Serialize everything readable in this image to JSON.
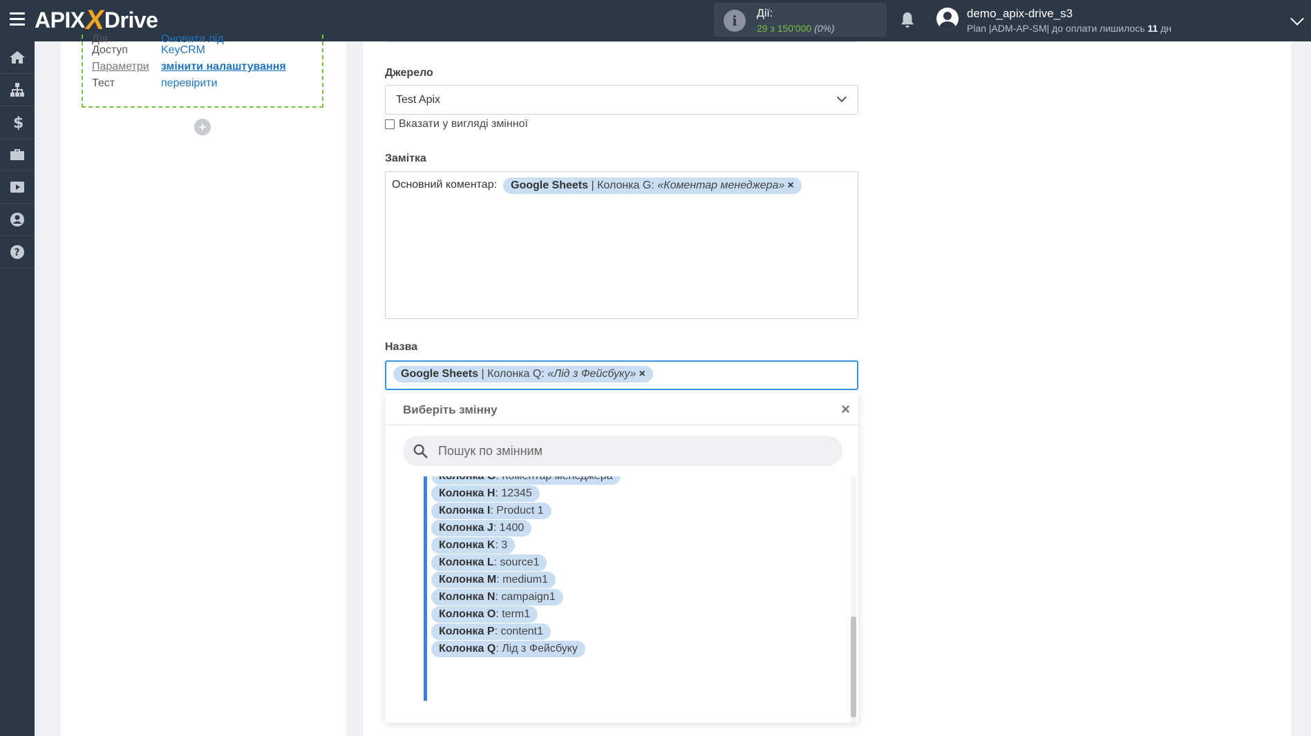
{
  "topbar": {
    "logo_api": "APIX",
    "logo_x": "",
    "logo_drive": "Drive",
    "actions_label": "Дії:",
    "actions_value": "29 з 150'000",
    "actions_percent": "(0%)",
    "username": "demo_apix-drive_s3",
    "plan_text": "Plan |ADM-AP-SM| до оплати лишилось ",
    "plan_days": "11",
    "plan_days_suffix": " дн"
  },
  "sidebar": {
    "items": [
      "home-icon",
      "sitemap-icon",
      "dollar-icon",
      "briefcase-icon",
      "youtube-icon",
      "user-icon",
      "help-icon"
    ]
  },
  "step": {
    "rows": [
      {
        "key": "Дія",
        "value": "Оновити лід"
      },
      {
        "key": "Доступ",
        "value": "KeyCRM"
      },
      {
        "key": "Параметри",
        "value": "змінити налаштування"
      },
      {
        "key": "Тест",
        "value": "перевірити"
      }
    ],
    "add_label": "+"
  },
  "form": {
    "source_label": "Джерело",
    "source_value": "Test Apix",
    "as_variable_label": "Вказати у вигляді змінної",
    "note_label": "Замітка",
    "note_prefix": "Основний коментар:",
    "note_tag_source": "Google Sheets",
    "note_tag_col": " | Колонка G: ",
    "note_tag_value": "«Коментар менеджера»",
    "name_label": "Назва",
    "name_tag_source": "Google Sheets",
    "name_tag_col": " | Колонка Q: ",
    "name_tag_value": "«Лід з Фейсбуку»",
    "tag_remove": "×"
  },
  "dropdown": {
    "title": "Виберіть змінну",
    "close": "×",
    "search_placeholder": "Пошук по змінним",
    "items": [
      {
        "col": "Колонка G",
        "value": "Коментар менеджера"
      },
      {
        "col": "Колонка H",
        "value": "12345"
      },
      {
        "col": "Колонка I",
        "value": "Product 1"
      },
      {
        "col": "Колонка J",
        "value": "1400"
      },
      {
        "col": "Колонка K",
        "value": "3"
      },
      {
        "col": "Колонка L",
        "value": "source1"
      },
      {
        "col": "Колонка M",
        "value": "medium1"
      },
      {
        "col": "Колонка N",
        "value": "campaign1"
      },
      {
        "col": "Колонка O",
        "value": "term1"
      },
      {
        "col": "Колонка P",
        "value": "content1"
      },
      {
        "col": "Колонка Q",
        "value": "Лід з Фейсбуку"
      }
    ]
  },
  "colors": {
    "topbar": "#2d3846",
    "accent_blue": "#3a93e0",
    "tag_bg": "#c9def3",
    "green": "#7bc043"
  }
}
